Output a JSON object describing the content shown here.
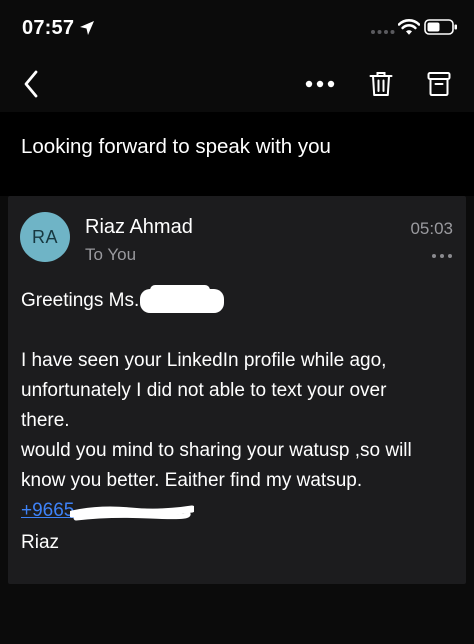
{
  "status_bar": {
    "time": "07:57",
    "icons": [
      "location-arrow-icon",
      "signal-icon",
      "wifi-icon",
      "battery-icon"
    ]
  },
  "nav": {
    "icons": [
      "back-chevron-icon",
      "more-horizontal-icon",
      "trash-icon",
      "archive-icon"
    ]
  },
  "email": {
    "subject": "Looking forward to speak with you",
    "avatar_initials": "RA",
    "sender": "Riaz Ahmad",
    "to": "To You",
    "time": "05:03",
    "body": {
      "greeting": "Greetings Ms.",
      "line1": "I have seen your LinkedIn profile while ago,",
      "line2": "unfortunately I did not able to text your over",
      "line3": "there.",
      "line4": "would you mind to sharing your watusp ,so will",
      "line5": "know you better. Eaither find my watsup.",
      "phone_visible": "+9665",
      "signature": "Riaz"
    }
  },
  "colors": {
    "background": "#0b0b0b",
    "card": "#1c1c1e",
    "avatar": "#6fb4c6",
    "link": "#3e82f7",
    "secondary_text": "#9a9a9f"
  }
}
